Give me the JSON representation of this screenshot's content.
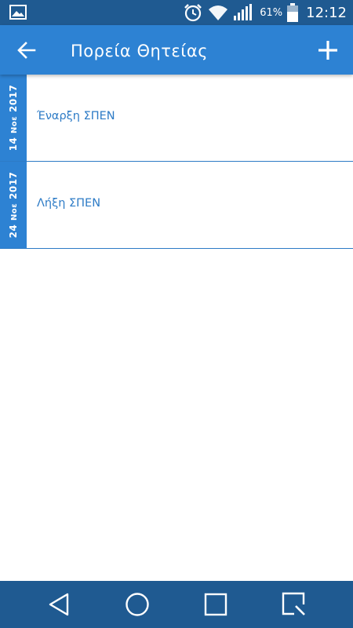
{
  "status_bar": {
    "battery_percent": "61%",
    "time": "12:12",
    "icons": [
      "image-icon",
      "alarm-icon",
      "wifi-icon",
      "signal-icon",
      "battery-icon"
    ]
  },
  "app_bar": {
    "title": "Πορεία Θητείας",
    "back_icon": "arrow-left-icon",
    "add_icon": "plus-icon"
  },
  "timeline": {
    "items": [
      {
        "day": "14",
        "month": "Νοε",
        "year": "2017",
        "label": "Έναρξη ΣΠΕΝ"
      },
      {
        "day": "24",
        "month": "Νοε",
        "year": "2017",
        "label": "Λήξη ΣΠΕΝ"
      }
    ]
  },
  "nav_bar": {
    "buttons": [
      "back-triangle-icon",
      "home-circle-icon",
      "recents-square-icon",
      "search-square-icon"
    ]
  },
  "colors": {
    "status_bar": "#1f5a91",
    "app_bar": "#2d82d3",
    "accent": "#2d7bc6",
    "nav_bar": "#1f5a91"
  }
}
